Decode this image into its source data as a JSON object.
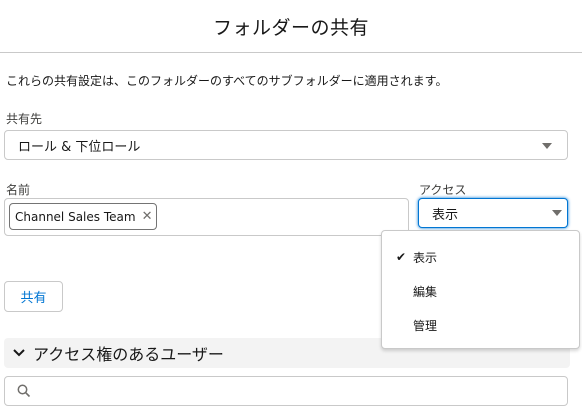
{
  "header": {
    "title": "フォルダーの共有"
  },
  "description": "これらの共有設定は、このフォルダーのすべてのサブフォルダーに適用されます。",
  "share_with": {
    "label": "共有先",
    "value": "ロール & 下位ロール"
  },
  "names": {
    "label": "名前",
    "pills": [
      "Channel Sales Team"
    ],
    "remove_symbol": "✕"
  },
  "access": {
    "label": "アクセス",
    "value": "表示",
    "options": [
      {
        "label": "表示",
        "checked": true
      },
      {
        "label": "編集",
        "checked": false
      },
      {
        "label": "管理",
        "checked": false
      }
    ],
    "check_symbol": "✔"
  },
  "share_button": {
    "label": "共有"
  },
  "users_section": {
    "title": "アクセス権のあるユーザー",
    "chevron_icon": "chevron-down-icon",
    "search_placeholder": ""
  },
  "colors": {
    "brand": "#0176d3",
    "border": "#c9c9c9",
    "section_bg": "#f3f3f3"
  }
}
